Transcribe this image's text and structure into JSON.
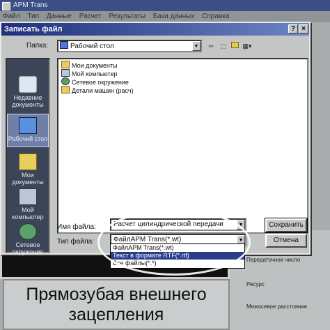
{
  "app": {
    "title": "APM Trans",
    "menu": [
      "Файл",
      "Тип",
      "Данные",
      "Расчет",
      "Результаты",
      "База данных",
      "Справка"
    ],
    "banner_line1": "Прямозубая внешнего",
    "banner_line2": "зацепления",
    "side_labels": [
      "Передаточное число",
      "Ресурс",
      "Межосевое расстояние"
    ]
  },
  "dialog": {
    "title": "Записать файл",
    "help_btn": "?",
    "close_btn": "×",
    "folder_label": "Папка:",
    "folder_value": "Рабочий стол",
    "places": [
      {
        "label": "Недавние документы",
        "icon": "recent-documents-icon"
      },
      {
        "label": "Рабочий стол",
        "icon": "desktop-icon"
      },
      {
        "label": "Мои документы",
        "icon": "my-documents-icon"
      },
      {
        "label": "Мой компьютер",
        "icon": "my-computer-icon"
      },
      {
        "label": "Сетевое окружение",
        "icon": "network-icon"
      }
    ],
    "files": [
      {
        "name": "Мои документы",
        "icon": "my-documents-icon"
      },
      {
        "name": "Мой компьютер",
        "icon": "my-computer-icon"
      },
      {
        "name": "Сетевое окружение",
        "icon": "network-icon"
      },
      {
        "name": "Детали машин (расч)",
        "icon": "folder-icon"
      }
    ],
    "filename_label": "Имя файла:",
    "filename_value": "Расчет цилиндрической передачи",
    "filetype_label": "Тип файла:",
    "filetype_value": "ФайлAPM Trans(*.wt)",
    "filetype_options": [
      "ФайлAPM Trans(*.wt)",
      "Текст в формате RTF(*.rtf)",
      "Все файлы(*.*)"
    ],
    "filetype_highlighted": 1,
    "save_label": "Сохранить",
    "cancel_label": "Отмена"
  }
}
